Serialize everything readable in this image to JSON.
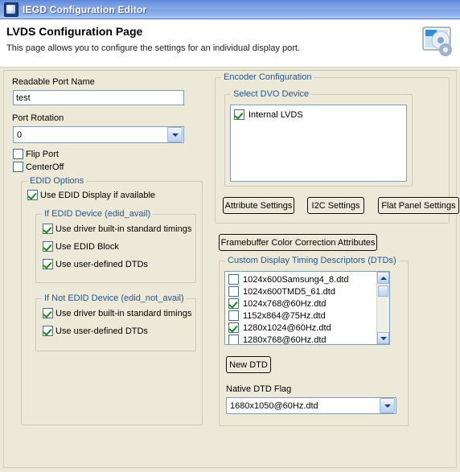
{
  "window": {
    "title": "IEGD Configuration Editor",
    "icon": "app-icon"
  },
  "header": {
    "title": "LVDS Configuration Page",
    "subtitle": "This page allows you to configure the settings for an individual display port.",
    "icon": "monitor-settings-icon"
  },
  "left": {
    "readable_port_name_label": "Readable Port Name",
    "readable_port_name_value": "test",
    "port_rotation_label": "Port Rotation",
    "port_rotation_value": "0",
    "flip_port": {
      "label": "Flip Port",
      "checked": false
    },
    "center_off": {
      "label": "CenterOff",
      "checked": false
    },
    "edid_options": {
      "title": "EDID Options",
      "use_edid_display": {
        "label": "Use EDID Display if available",
        "checked": true
      },
      "edid_avail": {
        "title": "If EDID Device (edid_avail)",
        "items": [
          {
            "label": "Use driver built-in standard timings",
            "checked": true
          },
          {
            "label": "Use EDID Block",
            "checked": true
          },
          {
            "label": "Use user-defined DTDs",
            "checked": true
          }
        ]
      },
      "edid_not_avail": {
        "title": "If Not EDID Device (edid_not_avail)",
        "items": [
          {
            "label": "Use driver built-in standard timings",
            "checked": true
          },
          {
            "label": "Use user-defined DTDs",
            "checked": true
          }
        ]
      }
    }
  },
  "right": {
    "encoder_configuration": {
      "title": "Encoder Configuration",
      "select_dvo_device": {
        "title": "Select DVO Device",
        "items": [
          {
            "label": "Internal LVDS",
            "checked": true
          }
        ]
      },
      "buttons": [
        {
          "label": "Attribute Settings"
        },
        {
          "label": "I2C Settings"
        },
        {
          "label": "Flat Panel Settings"
        }
      ]
    },
    "framebuffer_button": "Framebuffer Color Correction Attributes",
    "dtds": {
      "title": "Custom Display Timing Descriptors (DTDs)",
      "items": [
        {
          "label": "1024x600Samsung4_8.dtd",
          "checked": false
        },
        {
          "label": "1024x600TMD5_61.dtd",
          "checked": false
        },
        {
          "label": "1024x768@60Hz.dtd",
          "checked": true
        },
        {
          "label": "1152x864@75Hz.dtd",
          "checked": false
        },
        {
          "label": "1280x1024@60Hz.dtd",
          "checked": true
        },
        {
          "label": "1280x768@60Hz.dtd",
          "checked": false
        },
        {
          "label": "",
          "checked": false
        }
      ],
      "new_dtd_button": "New DTD",
      "native_dtd_flag_label": "Native DTD Flag",
      "native_dtd_flag_value": "1680x1050@60Hz.dtd"
    }
  },
  "colors": {
    "panel": "#ece9d8",
    "group_title": "#26568f",
    "title_bar": "#6b93de",
    "check": "#1a8a1a"
  }
}
